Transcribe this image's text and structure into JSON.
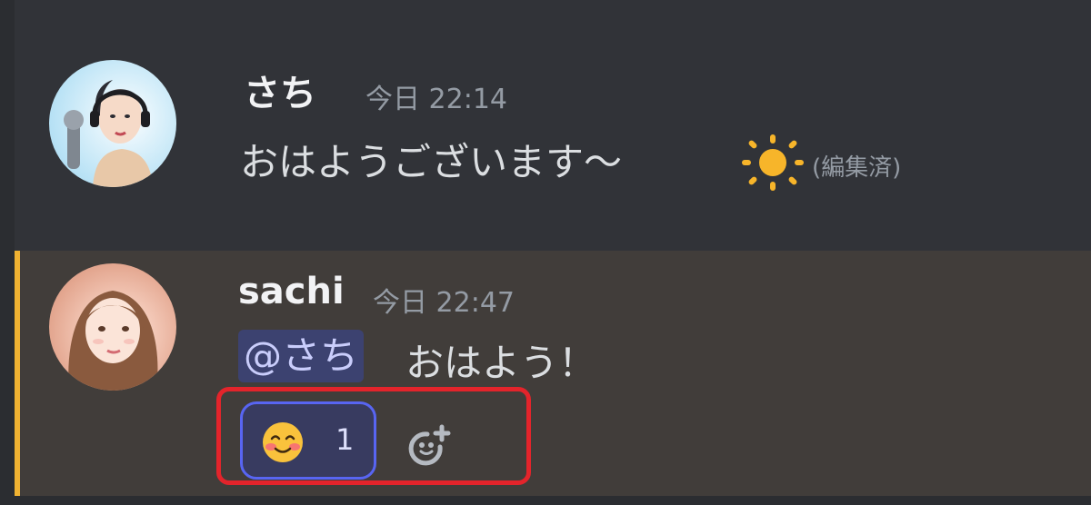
{
  "messages": [
    {
      "username": "さち",
      "timestamp": "今日 22:14",
      "text": "おはようございます〜",
      "emoji": "sun",
      "edited_label": "(編集済)",
      "avatar": "illustrated-woman-with-headphones"
    },
    {
      "username": "sachi",
      "timestamp": "今日 22:47",
      "mention": "@さち",
      "text": "おはよう！",
      "avatar": "illustrated-woman-long-hair",
      "reaction": {
        "emoji": "smiling-face-with-blush",
        "count": "1"
      }
    }
  ],
  "colors": {
    "background": "#313338",
    "mention_background": "#413d3a",
    "mention_bar": "#f0b232",
    "reaction_border": "#5865f2",
    "highlight_box": "#e3242b"
  }
}
